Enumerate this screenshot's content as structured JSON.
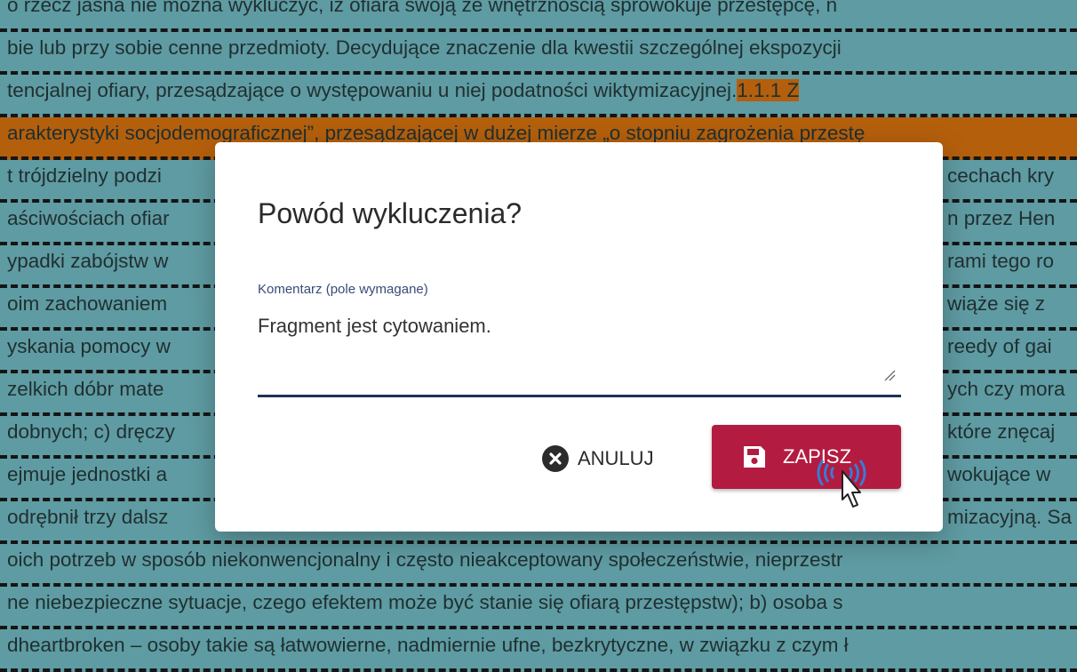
{
  "background_lines": [
    "o rzecz jasna nie można wykluczyć, iż ofiara swoją ze wnętrznością sprowokuje przestępcę, n",
    "bie lub przy sobie cenne przedmioty. Decydujące znaczenie dla kwestii szczególnej ekspozycji",
    "tencjalnej ofiary, przesądzające o występowaniu u niej podatności wiktymizacyjnej.",
    "arakterystyki socjodemograficznej”, przesądzającej w dużej mierze „o stopniu zagrożenia przestę",
    "t trójdzielny podzi",
    "aściwościach ofiar",
    "ypadki zabójstw w",
    "oim zachowaniem",
    "yskania pomocy w",
    "zelkich dóbr mate",
    "dobnych; c) dręczy",
    "ejmuje jednostki a",
    "odrębnił trzy dalsz",
    "oich potrzeb w sposób niekonwencjonalny i często nieakceptowany społeczeństwie, nieprzestr",
    "ne niebezpieczne sytuacje, czego efektem może być stanie się ofiarą przestępstw); b) osoba s",
    "dheartbroken – osoby takie są łatwowierne, nadmiernie ufne, bezkrytyczne, w związku z czym ł"
  ],
  "highlight_tail": "1.1.1   Z",
  "right_fragments": [
    "cechach kry",
    "n przez Hen",
    "rami tego ro",
    "wiąże się z",
    "reedy of gai",
    "ych czy mora",
    "które znęcaj",
    "wokujące w",
    "mizacyjną. Sa"
  ],
  "dialog": {
    "title": "Powód wykluczenia?",
    "field_label": "Komentarz (pole wymagane)",
    "field_value": "Fragment jest cytowaniem.",
    "cancel_label": "ANULUJ",
    "save_label": "ZAPISZ"
  },
  "icons": {
    "cancel": "close-circle-icon",
    "save": "floppy-disk-icon",
    "cursor": "hand-pointer-icon"
  },
  "colors": {
    "background": "#5f9ba2",
    "highlight": "#b45f0c",
    "save_button": "#b31b40",
    "field_underline": "#1d3258"
  }
}
